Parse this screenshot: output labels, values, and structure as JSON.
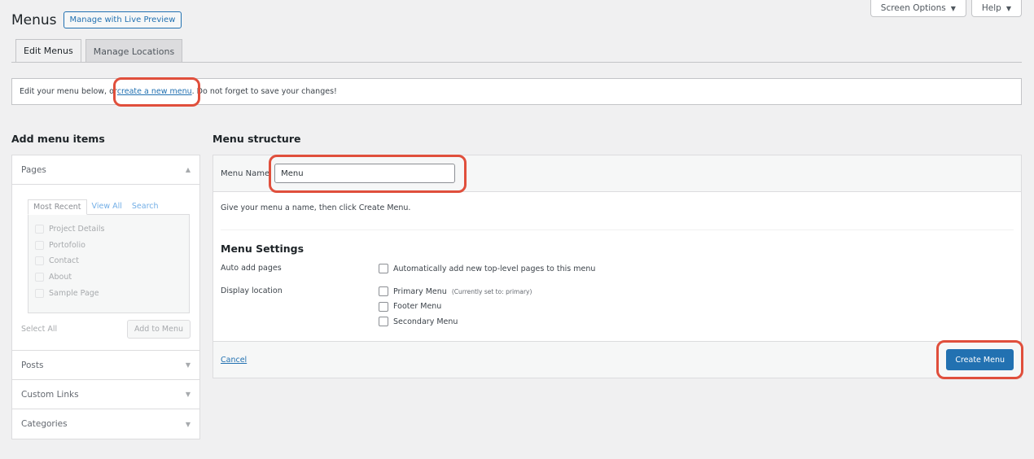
{
  "header": {
    "title": "Menus",
    "live_preview_label": "Manage with Live Preview",
    "screen_options_label": "Screen Options",
    "help_label": "Help",
    "dropdown_glyph": "▼"
  },
  "tabs": [
    {
      "label": "Edit Menus",
      "active": true
    },
    {
      "label": "Manage Locations",
      "active": false
    }
  ],
  "notice": {
    "before": "Edit your menu below, or ",
    "link": "create a new menu",
    "after": ". Do not forget to save your changes!"
  },
  "add_items": {
    "title": "Add menu items",
    "pages": {
      "label": "Pages",
      "tabs": [
        "Most Recent",
        "View All",
        "Search"
      ],
      "items": [
        "Project Details",
        "Portofolio",
        "Contact",
        "About",
        "Sample Page"
      ],
      "select_all": "Select All",
      "add_button": "Add to Menu"
    },
    "sections": [
      "Posts",
      "Custom Links",
      "Categories"
    ],
    "arrow_up": "▲",
    "arrow_down": "▼"
  },
  "structure": {
    "title": "Menu structure",
    "menu_name_label": "Menu Name",
    "menu_name_value": "Menu",
    "instructions": "Give your menu a name, then click Create Menu.",
    "settings_title": "Menu Settings",
    "auto_add_label": "Auto add pages",
    "auto_add_option": "Automatically add new top-level pages to this menu",
    "display_location_label": "Display location",
    "locations": [
      {
        "label": "Primary Menu",
        "note": "(Currently set to: primary)"
      },
      {
        "label": "Footer Menu",
        "note": ""
      },
      {
        "label": "Secondary Menu",
        "note": ""
      }
    ],
    "cancel_label": "Cancel",
    "create_button": "Create Menu"
  },
  "colors": {
    "accent": "#2271b1",
    "highlight": "#e04f3c",
    "background": "#f0f0f1"
  }
}
